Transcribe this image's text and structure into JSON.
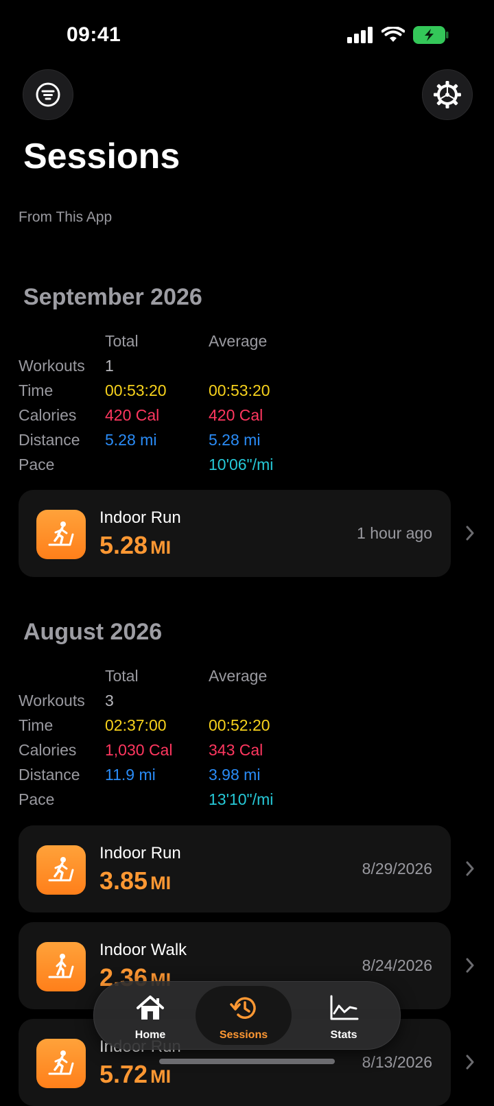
{
  "status": {
    "time": "09:41"
  },
  "header": {
    "title": "Sessions",
    "source": "From This App"
  },
  "columns": {
    "total": "Total",
    "average": "Average"
  },
  "row_labels": {
    "workouts": "Workouts",
    "time": "Time",
    "calories": "Calories",
    "distance": "Distance",
    "pace": "Pace"
  },
  "months": [
    {
      "title": "September 2026",
      "stats": {
        "workouts": "1",
        "time_total": "00:53:20",
        "time_avg": "00:53:20",
        "cal_total": "420 Cal",
        "cal_avg": "420 Cal",
        "dist_total": "5.28 mi",
        "dist_avg": "5.28 mi",
        "pace_avg": "10'06\"/mi"
      },
      "workouts": [
        {
          "name": "Indoor Run",
          "distance": "5.28",
          "unit": "MI",
          "date": "1 hour ago"
        }
      ]
    },
    {
      "title": "August 2026",
      "stats": {
        "workouts": "3",
        "time_total": "02:37:00",
        "time_avg": "00:52:20",
        "cal_total": "1,030 Cal",
        "cal_avg": "343 Cal",
        "dist_total": "11.9 mi",
        "dist_avg": "3.98 mi",
        "pace_avg": "13'10\"/mi"
      },
      "workouts": [
        {
          "name": "Indoor Run",
          "distance": "3.85",
          "unit": "MI",
          "date": "8/29/2026"
        },
        {
          "name": "Indoor Walk",
          "distance": "2.36",
          "unit": "MI",
          "date": "8/24/2026"
        },
        {
          "name": "Indoor Run",
          "distance": "5.72",
          "unit": "MI",
          "date": "8/13/2026"
        }
      ]
    }
  ],
  "tabs": [
    {
      "label": "Home"
    },
    {
      "label": "Sessions"
    },
    {
      "label": "Stats"
    }
  ],
  "colors": {
    "accent": "#ff9833",
    "time": "#f7d21c",
    "calories": "#ff375f",
    "distance": "#2a8cf7",
    "pace": "#26c9d8"
  }
}
